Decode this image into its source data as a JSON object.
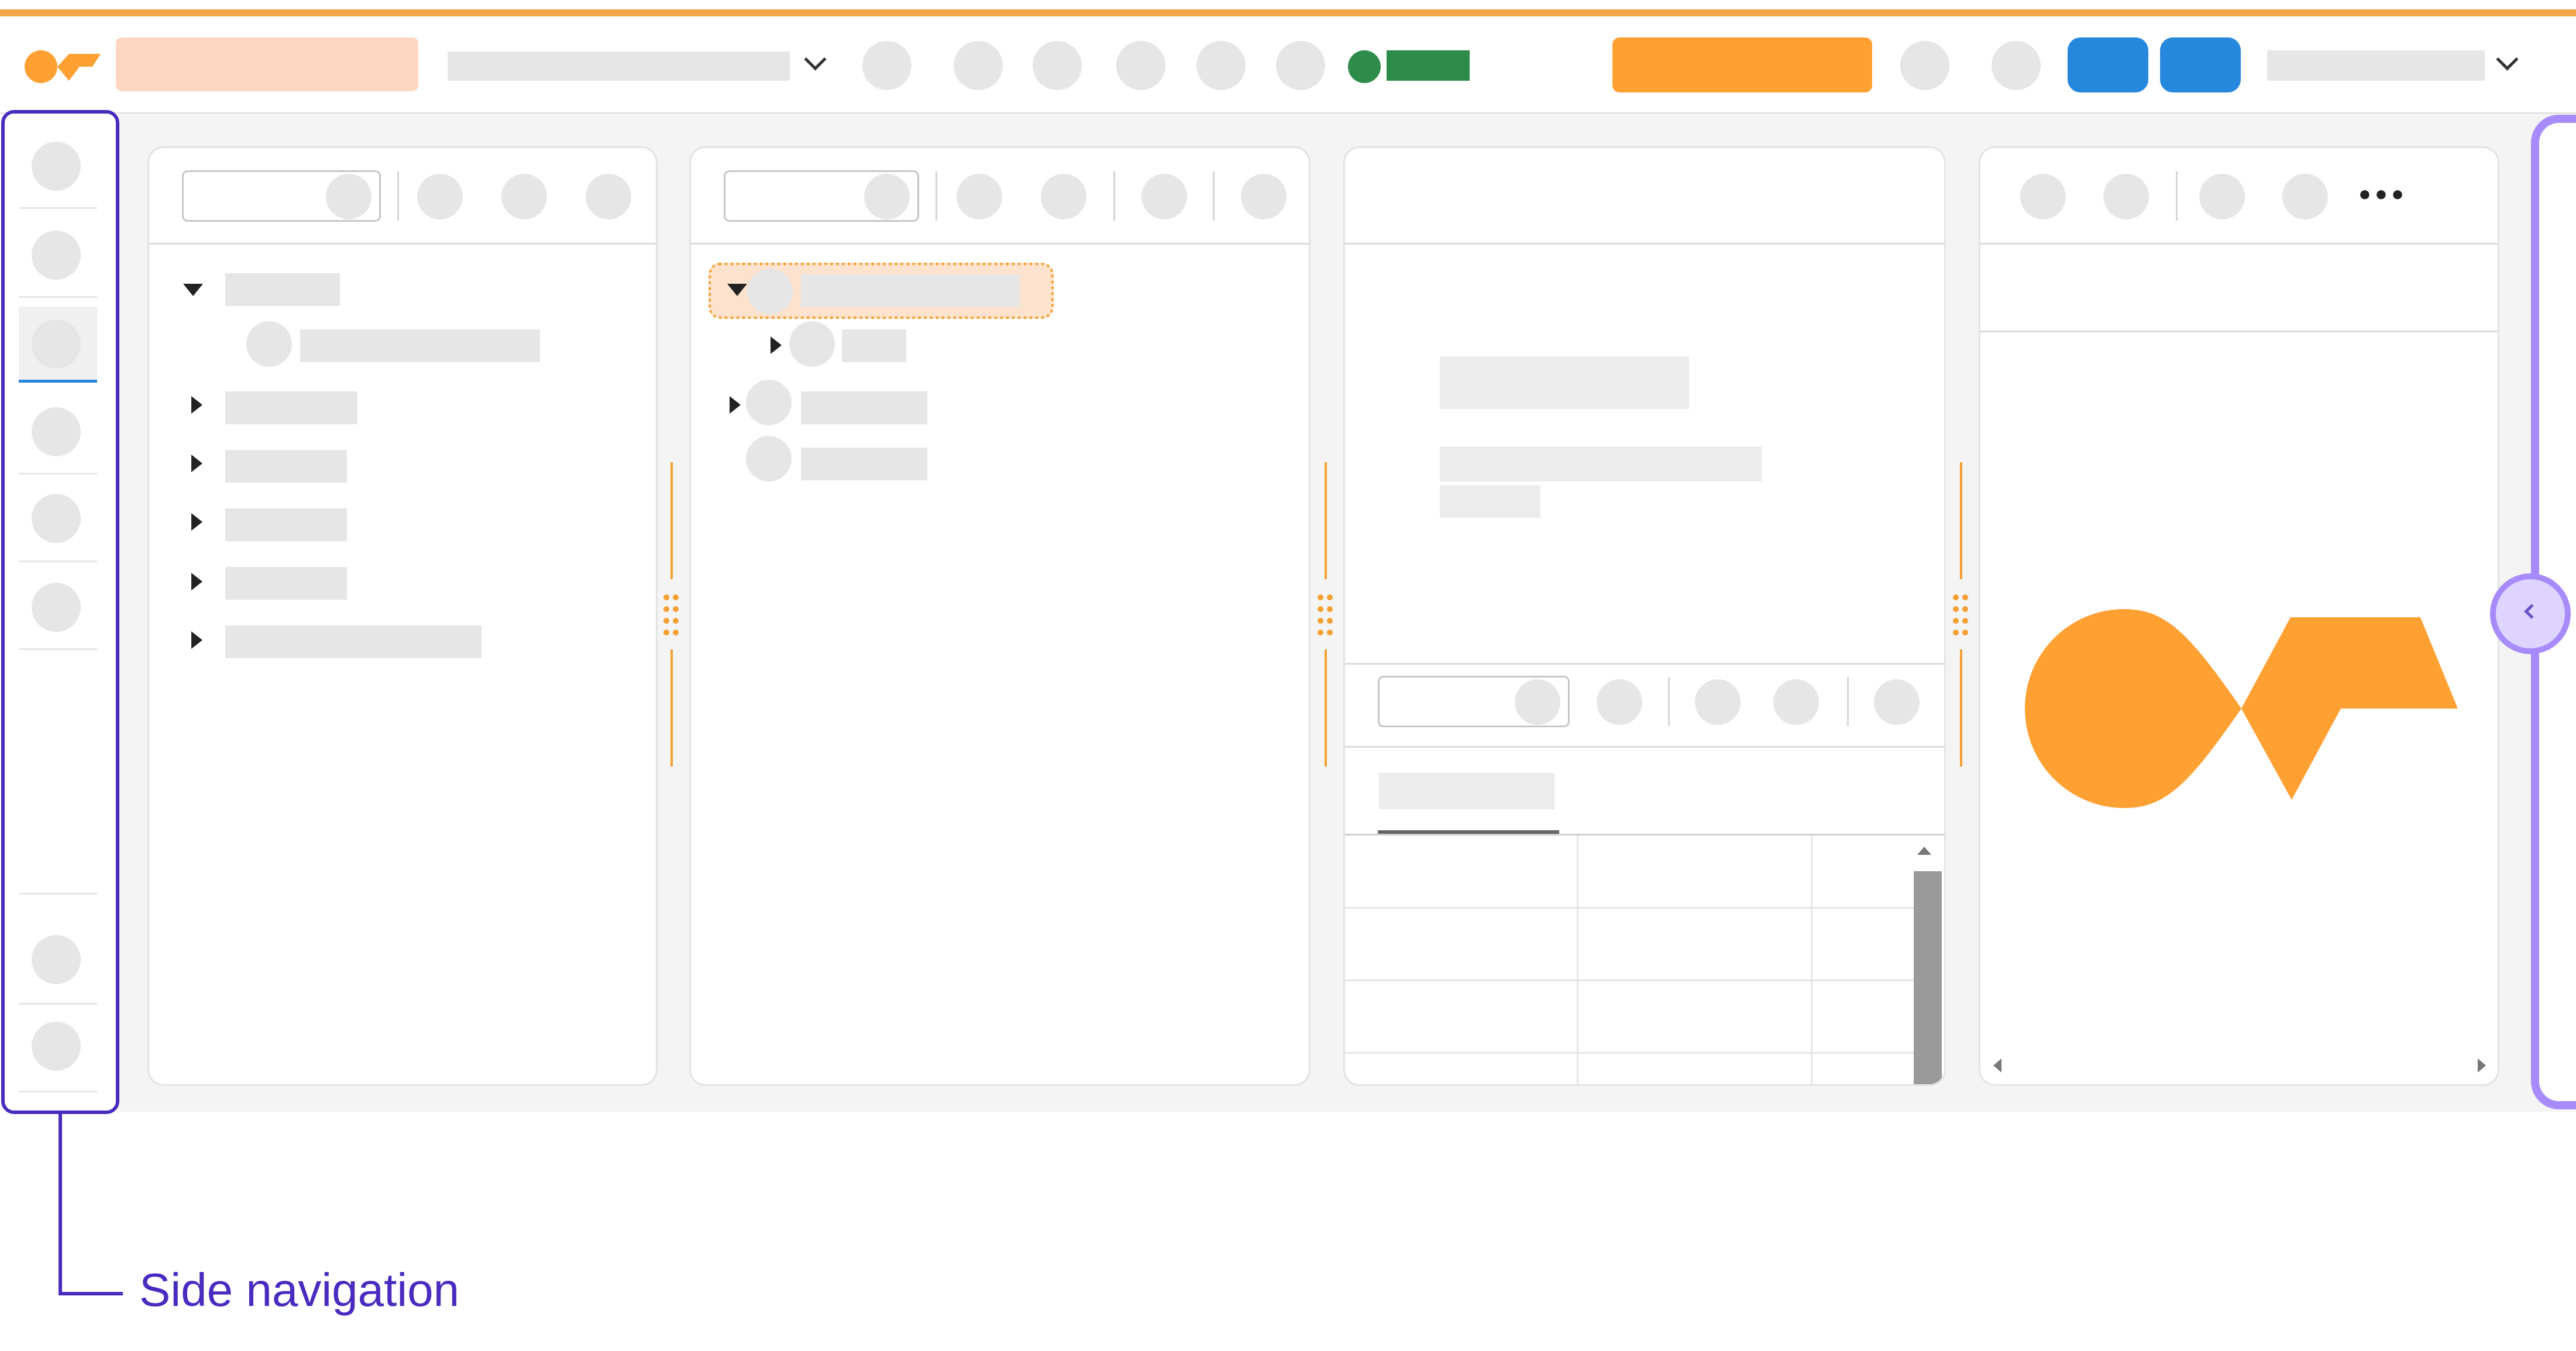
{
  "annotation": {
    "label": "Side navigation"
  },
  "panels": {
    "more_label": "•••"
  },
  "colors": {
    "accent_orange": "#ffa033",
    "accent_light": "#fdd7c2",
    "primary_blue": "#2688dd",
    "status_green": "#2e8b4a",
    "annotation_purple": "#4a2bbf",
    "collapsed_panel_purple": "#a78bfa"
  },
  "icons": [
    "logo-icon",
    "chevron-down-icon",
    "chevron-left-icon",
    "caret-right-icon",
    "caret-down-icon",
    "more-icon",
    "drag-handle-icon"
  ]
}
